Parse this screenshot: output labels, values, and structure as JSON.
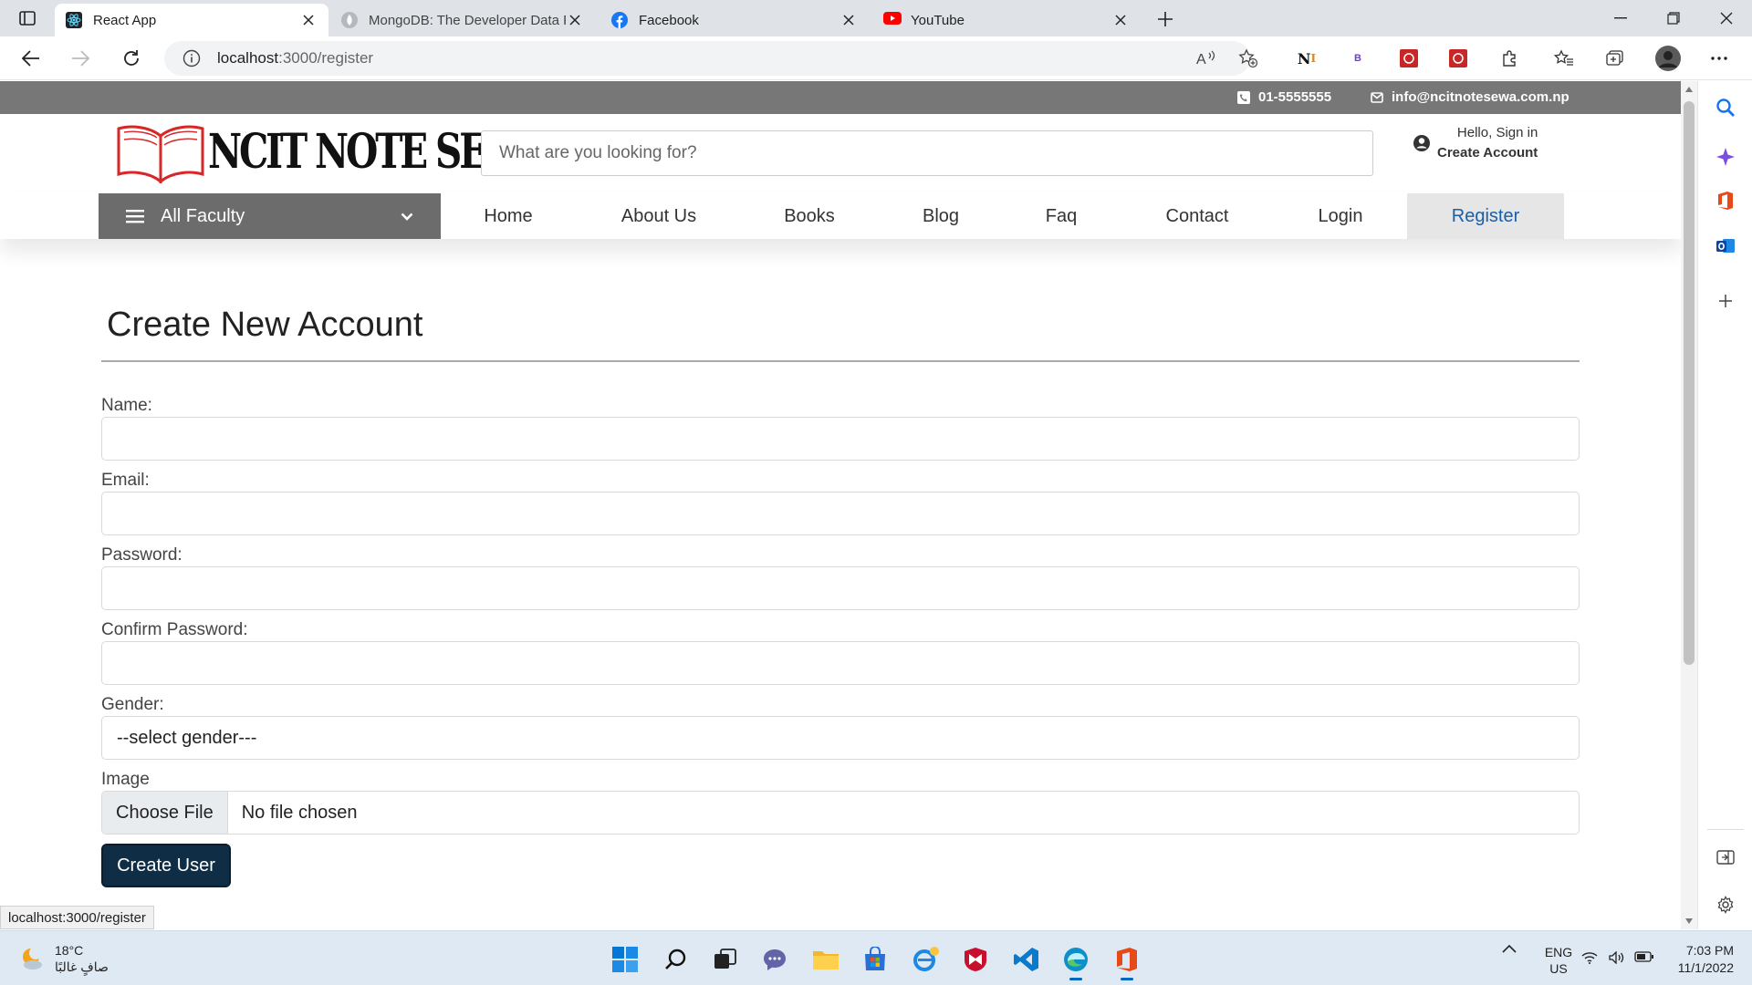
{
  "browser": {
    "tabs": [
      {
        "title": "React App",
        "icon": "react-icon",
        "active": true
      },
      {
        "title": "MongoDB: The Developer Data P",
        "icon": "mongodb-icon",
        "active": false
      },
      {
        "title": "Facebook",
        "icon": "facebook-icon",
        "active": false
      },
      {
        "title": "YouTube",
        "icon": "youtube-icon",
        "active": false
      }
    ],
    "url_host": "localhost",
    "url_path": ":3000/register",
    "status_url": "localhost:3000/register"
  },
  "site": {
    "phone": "01-5555555",
    "email": "info@ncitnotesewa.com.np",
    "logo_text": "NCIT NOTE SEWA",
    "search_placeholder": "What are you looking for?",
    "greeting": "Hello, Sign in",
    "create_account": "Create Account",
    "faculty_label": "All Faculty",
    "nav": [
      {
        "label": "Home",
        "active": false
      },
      {
        "label": "About Us",
        "active": false
      },
      {
        "label": "Books",
        "active": false
      },
      {
        "label": "Blog",
        "active": false
      },
      {
        "label": "Faq",
        "active": false
      },
      {
        "label": "Contact",
        "active": false
      },
      {
        "label": "Login",
        "active": false
      },
      {
        "label": "Register",
        "active": true
      }
    ]
  },
  "form": {
    "title": "Create New Account",
    "name_label": "Name:",
    "name_value": "",
    "email_label": "Email:",
    "email_value": "",
    "password_label": "Password:",
    "password_value": "",
    "confirm_label": "Confirm Password:",
    "confirm_value": "",
    "gender_label": "Gender:",
    "gender_selected": "--select gender---",
    "image_label": "Image",
    "choose_file": "Choose File",
    "no_file": "No file chosen",
    "submit": "Create User"
  },
  "taskbar": {
    "temperature": "18°C",
    "weather_desc": "صافٍ غالبًا",
    "lang_top": "ENG",
    "lang_bottom": "US",
    "time": "7:03 PM",
    "date": "11/1/2022"
  },
  "colors": {
    "topbar": "#777777",
    "faculty_bg": "#6c6c6c",
    "active_nav_text": "#1a5fa8",
    "submit_bg": "#0f2e46",
    "logo_red": "#d62828"
  }
}
